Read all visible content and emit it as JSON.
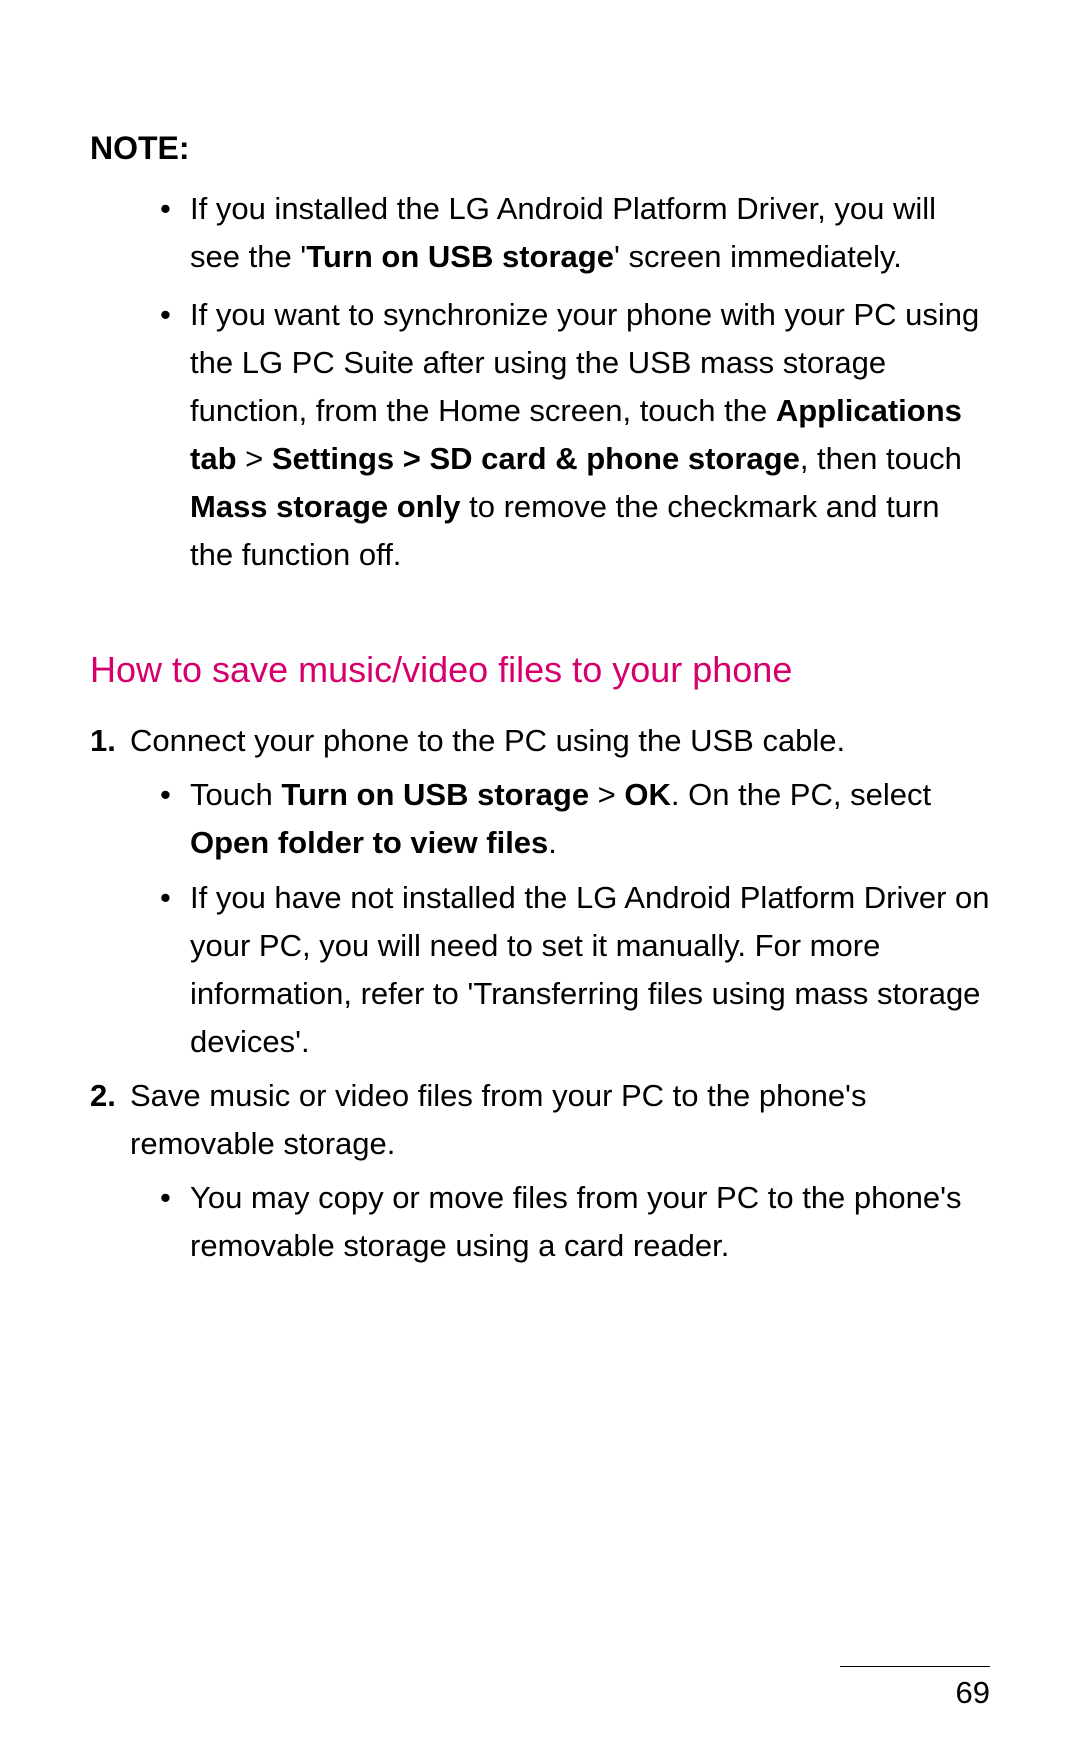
{
  "note": {
    "label": "NOTE:",
    "items": [
      {
        "pre": "If you installed the LG Android Platform Driver, you will see the '",
        "bold1": "Turn on USB storage",
        "post": "' screen immediately."
      },
      {
        "pre": "If you want to synchronize your phone with your PC using the LG PC Suite after using the USB mass storage function, from the Home screen, touch the ",
        "bold1": "Applications tab",
        "mid1": " > ",
        "bold2": "Settings > SD card & phone storage",
        "mid2": ", then touch ",
        "bold3": "Mass storage only",
        "post": " to remove the checkmark and turn the function off."
      }
    ]
  },
  "section": {
    "heading": "How to save music/video files to your phone",
    "steps": [
      {
        "num": "1.",
        "text": "Connect your phone to the PC using the USB cable.",
        "subs": [
          {
            "pre": "Touch ",
            "bold1": "Turn on USB storage",
            "mid1": " > ",
            "bold2": "OK",
            "mid2": ". On the PC, select ",
            "bold3": "Open folder to view files",
            "post": "."
          },
          {
            "pre": "If you have not installed the LG Android Platform Driver on your PC, you will need to set it manually. For more information, refer to 'Transferring files using mass storage devices'."
          }
        ]
      },
      {
        "num": "2.",
        "text": "Save music or video files from your PC to the phone's removable storage.",
        "subs": [
          {
            "pre": "You may copy or move files from your PC to the phone's removable storage using a card reader."
          }
        ]
      }
    ]
  },
  "pageNumber": "69"
}
